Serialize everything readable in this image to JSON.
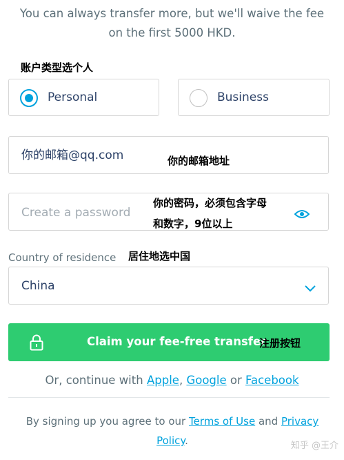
{
  "intro": {
    "line1": "You can always transfer more, but we'll waive the fee",
    "line2": "on the first 5000 HKD."
  },
  "annotations": {
    "account_type": "账户类型选个人",
    "email": "你的邮箱地址",
    "password_line1": "你的密码，必须包含字母",
    "password_line2": "和数字，9位以上",
    "country": "居住地选中国",
    "submit": "注册按钮"
  },
  "account_type": {
    "options": [
      {
        "label": "Personal",
        "selected": true
      },
      {
        "label": "Business",
        "selected": false
      }
    ]
  },
  "email": {
    "value": "你的邮箱@qq.com"
  },
  "password": {
    "placeholder": "Create a password",
    "icon": "eye-icon"
  },
  "country": {
    "label": "Country of residence",
    "value": "China",
    "icon": "chevron-down-icon"
  },
  "submit": {
    "label": "Claim your fee-free transfer",
    "icon": "lock-icon"
  },
  "social": {
    "prefix": "Or, continue with",
    "apple": "Apple",
    "comma": ",",
    "google": "Google",
    "or": "or",
    "facebook": "Facebook"
  },
  "terms": {
    "prefix": "By signing up you agree to our",
    "terms_link": "Terms of Use",
    "and": "and",
    "privacy_link": "Privacy Policy",
    "suffix": "."
  },
  "watermark": "知乎 @王介",
  "colors": {
    "accent": "#00a2dd",
    "cta": "#2ecc71",
    "text": "#2e4369",
    "muted": "#5d7079"
  }
}
